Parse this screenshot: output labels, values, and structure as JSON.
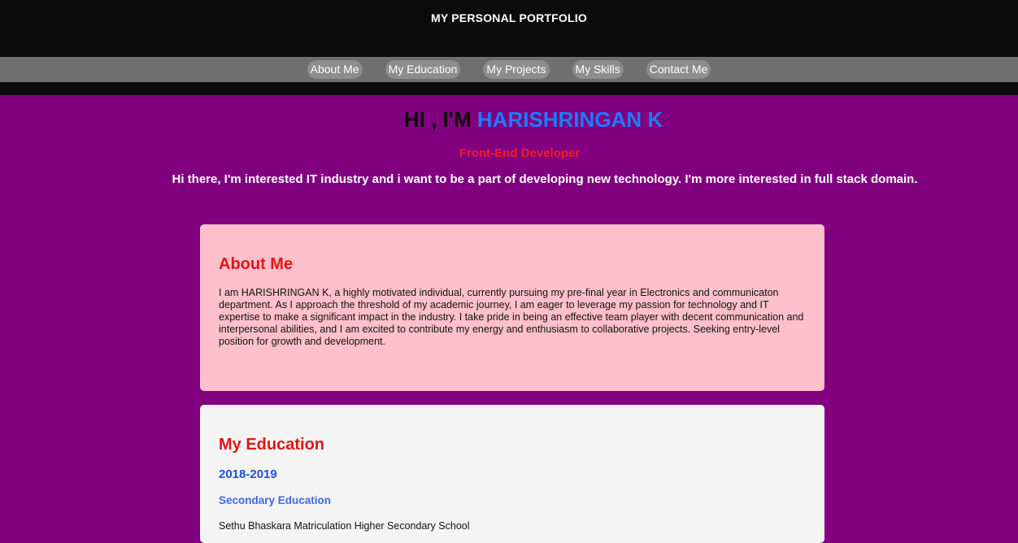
{
  "header": {
    "title": "MY PERSONAL PORTFOLIO"
  },
  "nav": {
    "items": [
      {
        "label": "About Me"
      },
      {
        "label": "My Education"
      },
      {
        "label": "My Projects"
      },
      {
        "label": "My Skills"
      },
      {
        "label": "Contact Me"
      }
    ]
  },
  "hero": {
    "greeting_prefix": "HI , I'M",
    "name": "HARISHRINGAN K",
    "role": "Front-End Developer",
    "intro": "Hi there, I'm interested IT industry and i want to be a part of developing new technology. I'm more interested in full stack domain."
  },
  "about": {
    "heading": "About Me",
    "text": "I am HARISHRINGAN K, a highly motivated individual, currently pursuing my pre-final year in Electronics and communicaton department. As I approach the threshold of my academic journey, I am eager to leverage my passion for technology and IT expertise to make a significant impact in the industry. I take pride in being an effective team player with decent communication and interpersonal abilities, and I am excited to contribute my energy and enthusiasm to collaborative projects. Seeking entry-level position for growth and development."
  },
  "education": {
    "heading": "My Education",
    "entries": [
      {
        "years": "2018-2019",
        "level": "Secondary Education",
        "school": "Sethu Bhaskara Matriculation Higher Secondary School"
      }
    ]
  },
  "colors": {
    "page_background": "#800080",
    "header_background": "#0b0b0b",
    "nav_background": "#6f6f6f",
    "name_accent": "#1e7bff",
    "role_red": "#ff1a1a",
    "heading_red": "#e11515",
    "about_card": "#ffc0cb",
    "education_card": "#f4f4f4"
  }
}
